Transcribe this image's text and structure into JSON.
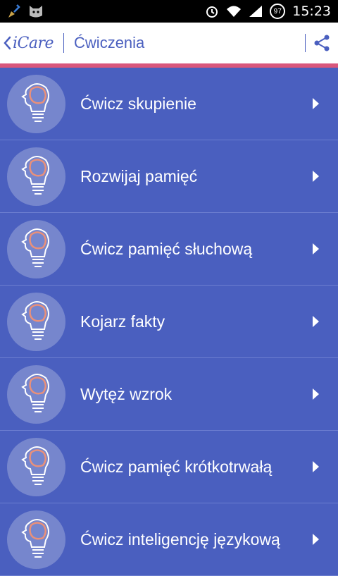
{
  "status_bar": {
    "time": "15:23",
    "battery": "97"
  },
  "app_bar": {
    "brand": "iCare",
    "title": "Ćwiczenia"
  },
  "items": [
    {
      "label": "Ćwicz skupienie"
    },
    {
      "label": "Rozwijaj pamięć"
    },
    {
      "label": "Ćwicz pamięć słuchową"
    },
    {
      "label": "Kojarz fakty"
    },
    {
      "label": "Wytęż wzrok"
    },
    {
      "label": "Ćwicz pamięć krótkotrwałą"
    },
    {
      "label": "Ćwicz inteligencję językową"
    }
  ],
  "colors": {
    "primary": "#4a5fbf",
    "accent": "#d9577c",
    "brain": "#e9907a"
  }
}
